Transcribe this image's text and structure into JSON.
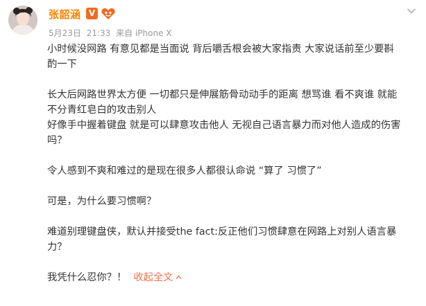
{
  "user": {
    "name": "张韶涵",
    "vip_mark": "V",
    "badge_icon": "heart-fan-badge-icon"
  },
  "meta": {
    "date": "5月23日",
    "time": "21:33",
    "source": "来自 iPhone X"
  },
  "post": {
    "p1": [
      "小时候没网路 有意见都是当面说 背后嚼舌根会被大家指责 大家说话前至少要斟",
      "酌一下"
    ],
    "p2a": [
      "长大后网路世界太方便 一切都只是伸展筋骨动动手的距离 想骂谁 看不爽谁 就能",
      "不分青红皂白的攻击别人"
    ],
    "p2b": [
      "好像手中握着键盘 就是可以肆意攻击他人 无视自己语言暴力而对他人造成的伤害",
      "吗？"
    ],
    "p3": "令人感到不爽和难过的是现在很多人都很认命说 “算了 习惯了”",
    "p4": "可是，为什么要习惯啊？",
    "p5": [
      "难道别理键盘侠，默认并接受the fact:反正他们习惯肆意在网路上对别人语言暴",
      "力？"
    ],
    "p6": "我凭什么忍你？！"
  },
  "actions": {
    "collapse_label": "收起全文"
  },
  "colors": {
    "username": "#ff8200",
    "link": "#eb7350",
    "meta": "#999999"
  }
}
